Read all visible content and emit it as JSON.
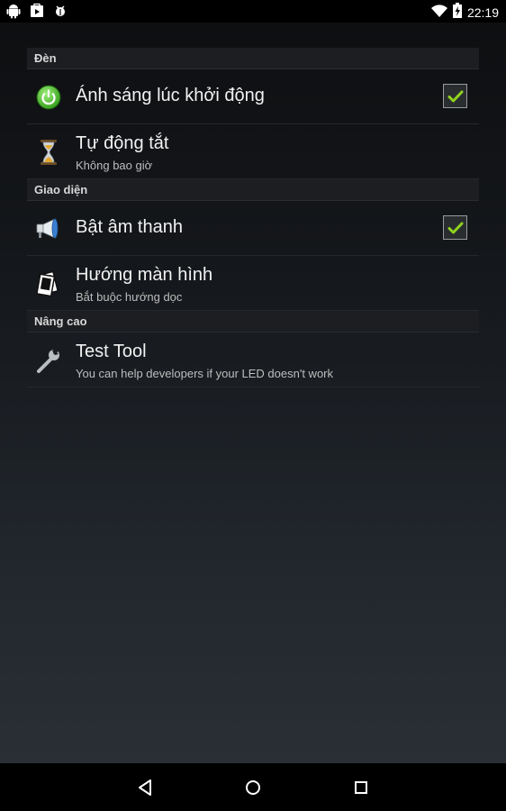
{
  "status_bar": {
    "time": "22:19",
    "left_icons": [
      "android-icon",
      "play-store-icon",
      "android-debug-icon"
    ],
    "right_icons": [
      "wifi-icon",
      "battery-charging-icon"
    ]
  },
  "sections": [
    {
      "header": "Đèn",
      "items": [
        {
          "title": "Ánh sáng lúc khởi động",
          "summary": "",
          "icon": "power-icon",
          "checked": true
        },
        {
          "title": "Tự động tắt",
          "summary": "Không bao giờ",
          "icon": "hourglass-icon"
        }
      ]
    },
    {
      "header": "Giao diện",
      "items": [
        {
          "title": "Bật âm thanh",
          "summary": "",
          "icon": "megaphone-icon",
          "checked": true
        },
        {
          "title": "Hướng màn hình",
          "summary": "Bắt buộc hướng dọc",
          "icon": "screen-rotation-icon"
        }
      ]
    },
    {
      "header": "Nâng cao",
      "items": [
        {
          "title": "Test Tool",
          "summary": "You can help developers if your LED doesn't work",
          "icon": "wrench-icon"
        }
      ]
    }
  ],
  "nav_bar": [
    "back-icon",
    "home-icon",
    "recents-icon"
  ],
  "colors": {
    "check_mark": "#8fd21e",
    "background_top": "#0d0e10",
    "background_bottom": "#2b3137"
  }
}
